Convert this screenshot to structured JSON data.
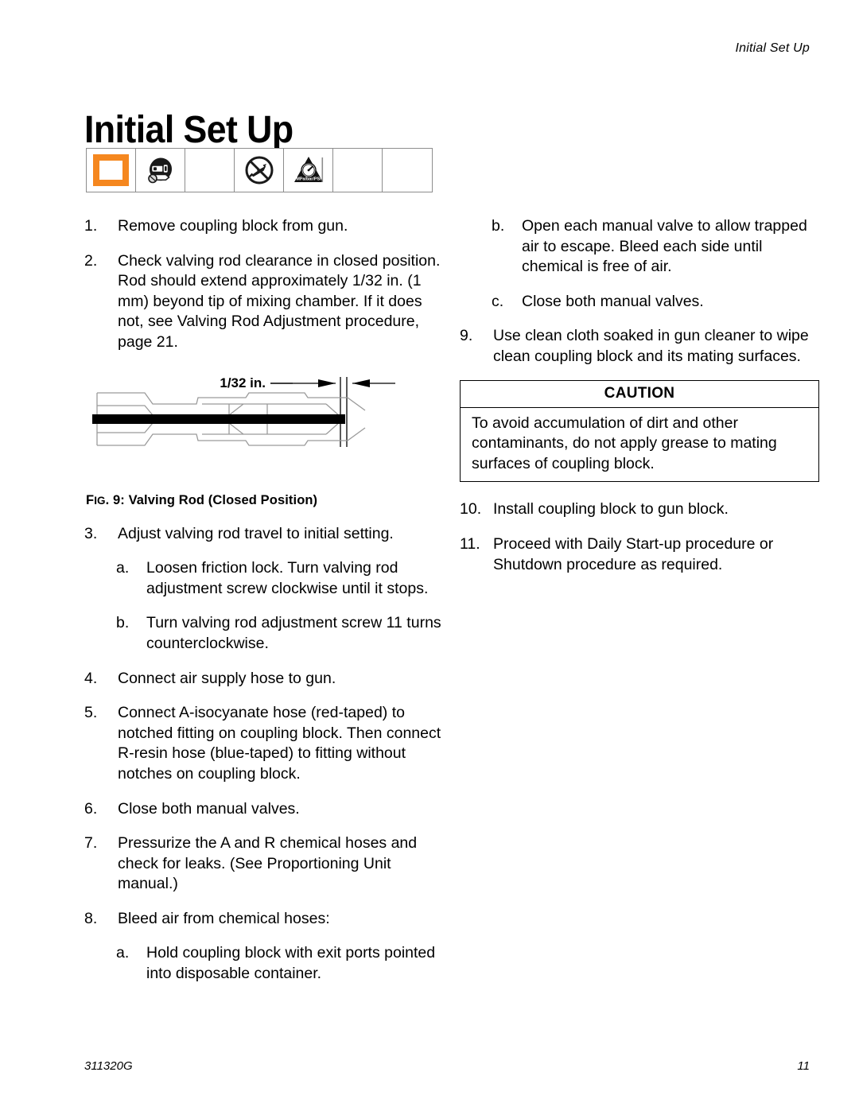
{
  "header": {
    "running_head": "Initial Set Up"
  },
  "title": "Initial Set Up",
  "symbol_strip": {
    "cells": [
      {
        "icon": "orange-box-icon",
        "label": ""
      },
      {
        "icon": "respirator-mask-icon",
        "label": ""
      },
      {
        "icon": "empty-cell",
        "label": ""
      },
      {
        "icon": "no-spray-prohibition-icon",
        "label": ""
      },
      {
        "icon": "pressure-warning-triangle-icon",
        "label": "MPa/bar/PSI"
      },
      {
        "icon": "empty-cell",
        "label": ""
      },
      {
        "icon": "empty-cell",
        "label": ""
      }
    ]
  },
  "left_column": {
    "steps": [
      {
        "marker": "1.",
        "text": "Remove coupling block from gun."
      },
      {
        "marker": "2.",
        "text": "Check valving rod clearance in closed position. Rod should extend approximately 1/32 in. (1 mm) beyond tip of mixing chamber. If it does not, see Valving Rod Adjustment procedure, page 21."
      },
      {
        "marker": "3.",
        "text": "Adjust valving rod travel to initial setting."
      },
      {
        "marker": "a.",
        "text": "Loosen friction lock. Turn valving rod adjustment screw clockwise until it stops."
      },
      {
        "marker": "b.",
        "text": "Turn valving rod adjustment screw 11 turns counterclockwise."
      },
      {
        "marker": "4.",
        "text": "Connect air supply hose to gun."
      },
      {
        "marker": "5.",
        "text": "Connect A-isocyanate hose (red-taped) to notched fitting on coupling block. Then connect R-resin hose (blue-taped) to fitting without notches on coupling block."
      },
      {
        "marker": "6.",
        "text": "Close both manual valves."
      },
      {
        "marker": "7.",
        "text": "Pressurize the A and R chemical hoses and check for leaks. (See Proportioning Unit manual.)"
      },
      {
        "marker": "8.",
        "text": "Bleed air from chemical hoses:"
      },
      {
        "marker": "a.",
        "text": "Hold coupling block with exit ports pointed into disposable container."
      }
    ],
    "figure": {
      "dimension_label": "1/32 in.",
      "caption_prefix": "F",
      "caption_smallcap": "IG",
      "caption_rest": ". 9: Valving Rod (Closed Position)"
    }
  },
  "right_column": {
    "steps_top": [
      {
        "marker": "b.",
        "text": "Open each manual valve to allow trapped air to escape. Bleed each side until chemical is free of air."
      },
      {
        "marker": "c.",
        "text": "Close both manual valves."
      },
      {
        "marker": "9.",
        "text": "Use clean cloth soaked in gun cleaner to wipe clean coupling block and its mating surfaces."
      }
    ],
    "caution": {
      "title": "CAUTION",
      "body": "To avoid accumulation of dirt and other contaminants, do not apply grease to mating surfaces of coupling block."
    },
    "steps_bottom": [
      {
        "marker": "10.",
        "text": "Install coupling block to gun block."
      },
      {
        "marker": "11.",
        "text": "Proceed with Daily Start-up procedure or Shutdown procedure as required."
      }
    ]
  },
  "footer": {
    "manual_number": "311320G",
    "page_number": "11"
  },
  "colors": {
    "accent_orange": "#F5871F",
    "rule": "#8d8d8d",
    "text": "#000000"
  }
}
